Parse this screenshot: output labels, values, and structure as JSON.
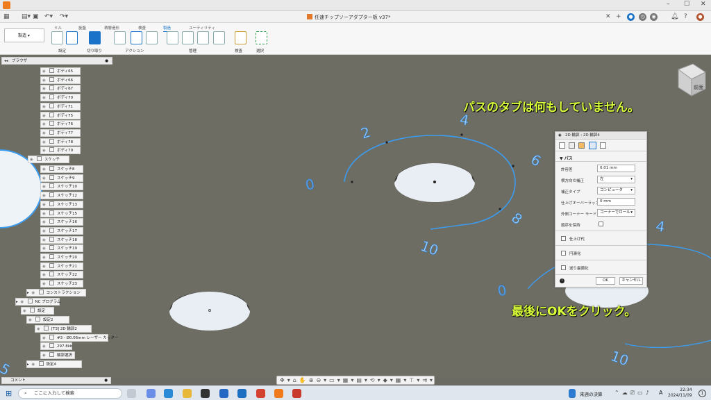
{
  "app": {
    "title": "任速チップソーアダプター板 v37*"
  },
  "toolbar": {
    "tabs": [
      "ミル",
      "旋盤",
      "積層造形",
      "検査",
      "製造",
      "ユーティリティ"
    ],
    "active_tab_index": 4,
    "workspace": "製造",
    "groups": [
      "設定",
      "切り取り",
      "アクション",
      "管理",
      "検査",
      "選択"
    ]
  },
  "browser": {
    "title": "ブラウザ",
    "bodies": [
      "ボディ65",
      "ボディ66",
      "ボディ67",
      "ボディ70",
      "ボディ71",
      "ボディ75",
      "ボディ76",
      "ボディ77",
      "ボディ78",
      "ボディ79"
    ],
    "sketch_folder": "スケッチ",
    "sketches": [
      "スケッチ8",
      "スケッチ9",
      "スケッチ10",
      "スケッチ12",
      "スケッチ13",
      "スケッチ15",
      "スケッチ16",
      "スケッチ17",
      "スケッチ18",
      "スケッチ19",
      "スケッチ20",
      "スケッチ21",
      "スケッチ22",
      "スケッチ23"
    ],
    "construction": "コンストラクション",
    "nc_program": "NC プログラム",
    "setup": "設定",
    "setup2": "設定2",
    "operation": "[T3] 2D 輪郭2",
    "tool": "#3 - Ø0.06mm レーザー カッター",
    "size": "297.8kb",
    "contour": "輪郭選択",
    "setup_last": "設定4"
  },
  "comments": {
    "label": "コメント"
  },
  "overlay": {
    "top_note": "パスのタブは何もしていません。",
    "bottom_note": "最後にOKをクリック。"
  },
  "viewcube": {
    "face": "前面"
  },
  "dialog": {
    "title": "2D 輪郭 : 2D 輪郭4",
    "section": "パス",
    "fields": [
      {
        "label": "許容差",
        "value": "0.01 mm"
      },
      {
        "label": "横方向の補正",
        "value": "左"
      },
      {
        "label": "補正タイプ",
        "value": "コンピュータ"
      },
      {
        "label": "仕上げオーバーラップ",
        "value": "0 mm"
      },
      {
        "label": "外側コーナー モード",
        "value": "コーナーでロール"
      },
      {
        "label": "順序を保持",
        "value": ""
      }
    ],
    "checks": [
      "仕上げ代",
      "円滑化",
      "送り最適化"
    ],
    "ok": "OK",
    "cancel": "キャンセル"
  },
  "scene": {
    "labels_ring1": [
      "2",
      "4",
      "6",
      "8",
      "10",
      "0"
    ],
    "labels_ring2": [
      "4",
      "0",
      "10",
      "5"
    ]
  },
  "taskbar": {
    "search_placeholder": "ここに入力して検索",
    "news": "来週の決算",
    "time": "22:34",
    "date": "2024/11/09",
    "ime": "A"
  },
  "colors": {
    "accent": "#1a73c9",
    "annotation": "#d9ff3a",
    "path": "#3b9cf0",
    "ground": "#6d6d64"
  }
}
